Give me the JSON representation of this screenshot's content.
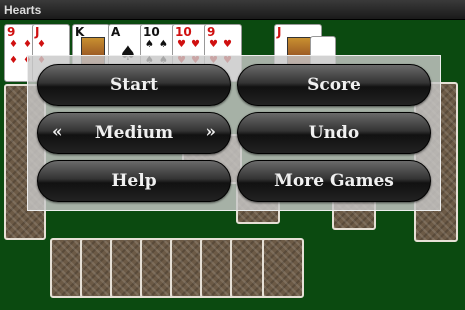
{
  "window": {
    "title": "Hearts"
  },
  "top_cards": [
    {
      "rank": "9",
      "suit": "♦",
      "color": "red"
    },
    {
      "rank": "J",
      "suit": "♦",
      "color": "red"
    },
    {
      "rank": "K",
      "suit": "♣",
      "color": "black"
    },
    {
      "rank": "A",
      "suit": "♠",
      "color": "black"
    },
    {
      "rank": "10",
      "suit": "♠",
      "color": "black"
    },
    {
      "rank": "10",
      "suit": "♥",
      "color": "red"
    },
    {
      "rank": "9",
      "suit": "♥",
      "color": "red"
    },
    {
      "rank": "J",
      "suit": "♥",
      "color": "red"
    }
  ],
  "menu": {
    "start_label": "Start",
    "score_label": "Score",
    "difficulty_label": "Medium",
    "prev_arrow": "«",
    "next_arrow": "»",
    "undo_label": "Undo",
    "help_label": "Help",
    "more_games_label": "More Games"
  }
}
